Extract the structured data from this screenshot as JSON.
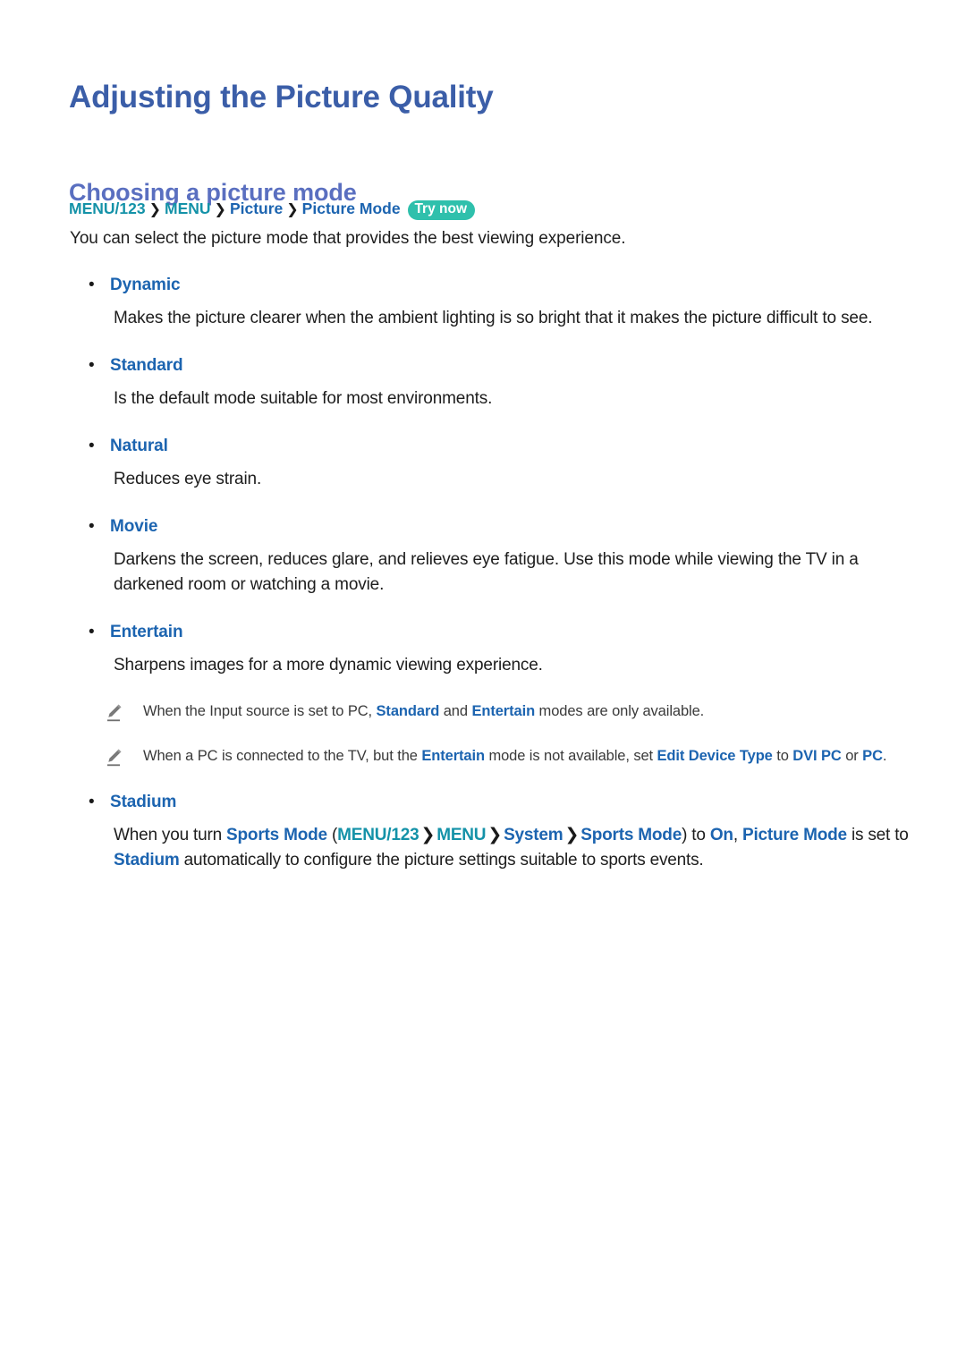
{
  "document": {
    "title": "Adjusting the Picture Quality",
    "section_heading": "Choosing a picture mode"
  },
  "colors": {
    "title_blue": "#3b5ea8",
    "heading_blue": "#5a6fc0",
    "link_blue": "#1c64b0",
    "menu_teal": "#1492a8",
    "badge_teal": "#2fc0ac",
    "body_text": "#1d1d1d",
    "note_text": "#3a3a3a",
    "page_background": "#ffffff"
  },
  "breadcrumb": {
    "items": [
      {
        "label": "MENU/123",
        "style": "teal"
      },
      {
        "label": "MENU",
        "style": "teal"
      },
      {
        "label": "Picture",
        "style": "blue"
      },
      {
        "label": "Picture Mode",
        "style": "blue"
      }
    ],
    "separator": "❯",
    "badge": "Try now"
  },
  "intro": "You can select the picture mode that provides the best viewing experience.",
  "modes": [
    {
      "name": "Dynamic",
      "description": "Makes the picture clearer when the ambient lighting is so bright that it makes the picture difficult to see."
    },
    {
      "name": "Standard",
      "description": "Is the default mode suitable for most environments."
    },
    {
      "name": "Natural",
      "description": "Reduces eye strain."
    },
    {
      "name": "Movie",
      "description": "Darkens the screen, reduces glare, and relieves eye fatigue. Use this mode while viewing the TV in a darkened room or watching a movie."
    },
    {
      "name": "Entertain",
      "description": "Sharpens images for a more dynamic viewing experience."
    }
  ],
  "notes": [
    {
      "icon": "pencil-note-icon",
      "segments": [
        {
          "text": "When the Input source is set to PC, ",
          "style": "plain"
        },
        {
          "text": "Standard",
          "style": "term"
        },
        {
          "text": " and ",
          "style": "plain"
        },
        {
          "text": "Entertain",
          "style": "term"
        },
        {
          "text": " modes are only available.",
          "style": "plain"
        }
      ]
    },
    {
      "icon": "pencil-note-icon",
      "segments": [
        {
          "text": "When a PC is connected to the TV, but the ",
          "style": "plain"
        },
        {
          "text": "Entertain",
          "style": "term"
        },
        {
          "text": " mode is not available, set ",
          "style": "plain"
        },
        {
          "text": "Edit Device Type",
          "style": "term"
        },
        {
          "text": " to ",
          "style": "plain"
        },
        {
          "text": "DVI PC",
          "style": "term"
        },
        {
          "text": " or ",
          "style": "plain"
        },
        {
          "text": "PC",
          "style": "term"
        },
        {
          "text": ".",
          "style": "plain"
        }
      ]
    }
  ],
  "stadium": {
    "name": "Stadium",
    "segments": [
      {
        "text": "When you turn ",
        "style": "plain"
      },
      {
        "text": "Sports Mode",
        "style": "blue"
      },
      {
        "text": " (",
        "style": "plain"
      },
      {
        "text": "MENU/123",
        "style": "teal"
      },
      {
        "text": "❯",
        "style": "sep"
      },
      {
        "text": "MENU",
        "style": "teal"
      },
      {
        "text": "❯",
        "style": "sep"
      },
      {
        "text": "System",
        "style": "blue"
      },
      {
        "text": "❯",
        "style": "sep"
      },
      {
        "text": "Sports Mode",
        "style": "blue"
      },
      {
        "text": ") to ",
        "style": "plain"
      },
      {
        "text": "On",
        "style": "blue"
      },
      {
        "text": ", ",
        "style": "plain"
      },
      {
        "text": "Picture Mode",
        "style": "blue"
      },
      {
        "text": " is set to ",
        "style": "plain"
      },
      {
        "text": "Stadium",
        "style": "blue"
      },
      {
        "text": " automatically to configure the picture settings suitable to sports events.",
        "style": "plain"
      }
    ]
  }
}
